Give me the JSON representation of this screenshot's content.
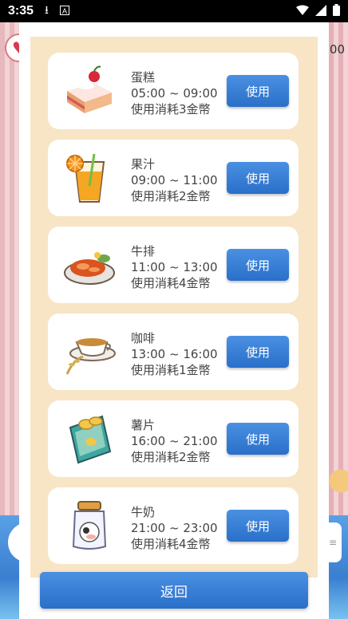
{
  "status_bar": {
    "time": "3:35",
    "icons": [
      "download-icon",
      "font-icon",
      "wifi-icon",
      "signal-icon",
      "battery-icon"
    ]
  },
  "background": {
    "coin_text": "00",
    "right_chip_text": "≡"
  },
  "items": [
    {
      "name": "蛋糕",
      "time": "05:00 ~ 09:00",
      "cost": "使用消耗3金幣",
      "button": "使用",
      "icon": "cake-icon"
    },
    {
      "name": "果汁",
      "time": "09:00 ~ 11:00",
      "cost": "使用消耗2金幣",
      "button": "使用",
      "icon": "juice-icon"
    },
    {
      "name": "牛排",
      "time": "11:00 ~ 13:00",
      "cost": "使用消耗4金幣",
      "button": "使用",
      "icon": "steak-icon"
    },
    {
      "name": "咖啡",
      "time": "13:00 ~ 16:00",
      "cost": "使用消耗1金幣",
      "button": "使用",
      "icon": "coffee-icon"
    },
    {
      "name": "薯片",
      "time": "16:00 ~ 21:00",
      "cost": "使用消耗2金幣",
      "button": "使用",
      "icon": "chips-icon"
    },
    {
      "name": "牛奶",
      "time": "21:00 ~ 23:00",
      "cost": "使用消耗4金幣",
      "button": "使用",
      "icon": "milk-icon"
    }
  ],
  "back_button": "返回",
  "colors": {
    "button_blue": "#2a6fc9",
    "panel_beige": "#f7e5c6"
  }
}
